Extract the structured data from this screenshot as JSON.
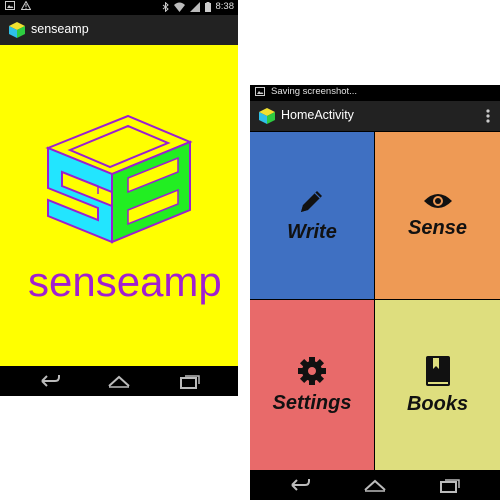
{
  "left_phone": {
    "status_time": "8:38",
    "app_title": "senseamp",
    "splash_wordmark": "senseamp",
    "colors": {
      "background": "#ffff00",
      "logo_cyan": "#22e5ff",
      "logo_green": "#22ee22",
      "logo_outline": "#9a1fd0"
    }
  },
  "right_phone": {
    "status_text": "Saving screenshot...",
    "activity_title": "HomeActivity",
    "tiles": [
      {
        "label": "Write",
        "icon": "pencil-icon",
        "color": "#3f70c2"
      },
      {
        "label": "Sense",
        "icon": "eye-icon",
        "color": "#ee9a55"
      },
      {
        "label": "Settings",
        "icon": "gear-icon",
        "color": "#e86a6a"
      },
      {
        "label": "Books",
        "icon": "book-icon",
        "color": "#dede7e"
      }
    ]
  }
}
